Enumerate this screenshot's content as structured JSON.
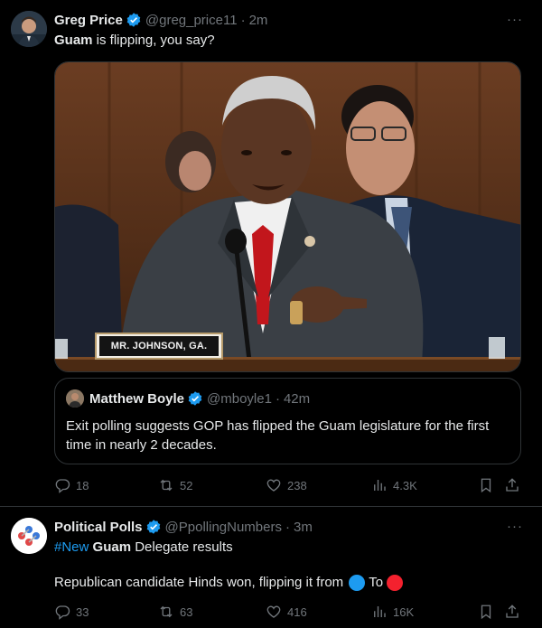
{
  "tweet1": {
    "author_name": "Greg Price",
    "author_handle": "@greg_price11",
    "time": "2m",
    "text_bold": "Guam",
    "text_rest": " is flipping, you say?",
    "media": {
      "nameplate": "MR. JOHNSON, GA."
    },
    "quote": {
      "author_name": "Matthew Boyle",
      "author_handle": "@mboyle1",
      "time": "42m",
      "text": "Exit polling suggests GOP has flipped the Guam legislature for the first time in nearly 2 decades."
    },
    "stats": {
      "replies": "18",
      "reposts": "52",
      "likes": "238",
      "views": "4.3K"
    }
  },
  "tweet2": {
    "author_name": "Political Polls",
    "author_handle": "@PpollingNumbers",
    "time": "3m",
    "hashtag": "#New",
    "text_bold": "Guam",
    "text_rest": " Delegate results",
    "line2_before": "Republican candidate Hinds won, flipping it from",
    "line2_middle": "To",
    "stats": {
      "replies": "33",
      "reposts": "63",
      "likes": "416",
      "views": "16K"
    }
  },
  "separators": {
    "dot": "·",
    "more": "···"
  },
  "colors": {
    "verified": "#1d9bf0",
    "blue_circle": "#1d9bf0",
    "red_circle": "#f4212e",
    "muted": "#71767b"
  },
  "icons": [
    "verified-badge-icon",
    "more-icon",
    "reply-icon",
    "repost-icon",
    "like-icon",
    "views-icon",
    "bookmark-icon",
    "share-icon"
  ]
}
